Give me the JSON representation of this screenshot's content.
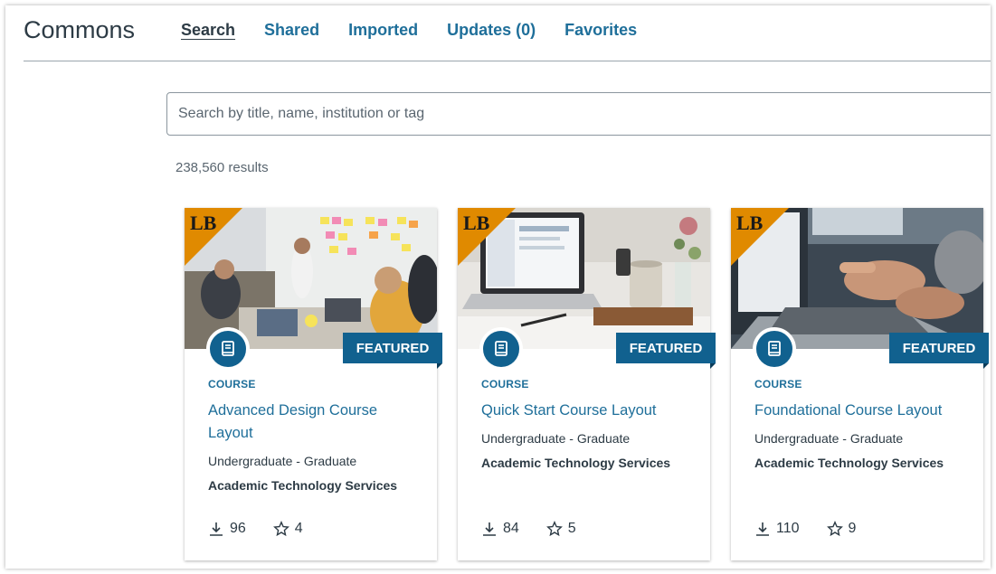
{
  "header": {
    "title": "Commons",
    "tabs": [
      {
        "label": "Search"
      },
      {
        "label": "Shared"
      },
      {
        "label": "Imported"
      },
      {
        "label": "Updates (0)"
      },
      {
        "label": "Favorites"
      }
    ]
  },
  "search": {
    "placeholder": "Search by title, name, institution or tag",
    "value": ""
  },
  "results": {
    "count_text": "238,560 results"
  },
  "cards": [
    {
      "corner_logo": "LB",
      "badge": "FEATURED",
      "type": "COURSE",
      "title": "Advanced Design Course Layout",
      "level": "Undergraduate - Graduate",
      "org": "Academic Technology Services",
      "downloads": "96",
      "favorites": "4",
      "icon": "book-icon"
    },
    {
      "corner_logo": "LB",
      "badge": "FEATURED",
      "type": "COURSE",
      "title": "Quick Start Course Layout",
      "level": "Undergraduate - Graduate",
      "org": "Academic Technology Services",
      "downloads": "84",
      "favorites": "5",
      "icon": "book-icon"
    },
    {
      "corner_logo": "LB",
      "badge": "FEATURED",
      "type": "COURSE",
      "title": "Foundational Course Layout",
      "level": "Undergraduate - Graduate",
      "org": "Academic Technology Services",
      "downloads": "110",
      "favorites": "9",
      "icon": "book-icon"
    }
  ],
  "colors": {
    "accent": "#1f6f9a",
    "featured": "#11618f",
    "corner": "#e08a00"
  }
}
